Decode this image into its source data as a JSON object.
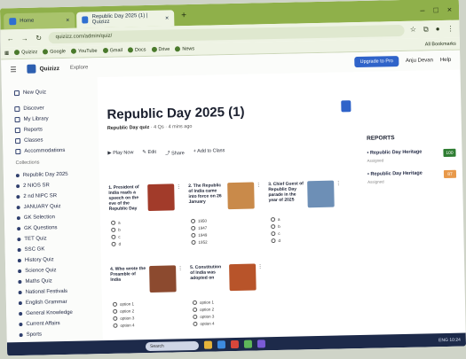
{
  "browser": {
    "tabs": [
      {
        "label": "Home"
      },
      {
        "label": "Republic Day 2025 (1) | Quizizz"
      }
    ],
    "url": "quizizz.com/admin/quiz/",
    "bookmarks": [
      "Quizizz",
      "Google",
      "YouTube",
      "Gmail",
      "Docs",
      "Drive",
      "News",
      "All Bookmarks"
    ]
  },
  "app": {
    "brand": "Quizizz",
    "nav_link": "Explore",
    "upgrade_label": "Upgrade to Pro",
    "user_label": "Anju Devan",
    "help_label": "Help"
  },
  "sidebar": {
    "top_items": [
      "New Quiz",
      "Discover",
      "My Library",
      "Reports",
      "Classes",
      "Accommodations"
    ],
    "section_label": "Collections",
    "collections": [
      "Republic Day 2025",
      "2 NIOS SR",
      "2 nd NIPC SR",
      "JANUARY Quiz",
      "GK Selection",
      "GK Questions",
      "TET Quiz",
      "SSC GK",
      "History Quiz",
      "Science Quiz",
      "Maths Quiz",
      "National Festivals",
      "English Grammar",
      "General Knowledge",
      "Current Affairs",
      "Sports"
    ]
  },
  "main": {
    "title": "Republic Day 2025 (1)",
    "subtitle_bold": "Republic Day quiz",
    "subtitle_rest": " · 4 Qs · 4 mins ago",
    "actions": [
      "Play Now",
      "Edit",
      "Share",
      "Add to Class"
    ],
    "cards": [
      {
        "title": "1. President of India reads a speech on the eve of the Republic Day",
        "thumb": "#a23b2a",
        "options": [
          "a",
          "b",
          "c",
          "d"
        ]
      },
      {
        "title": "2. The Republic of India came into force on 26 January",
        "thumb": "#c98a4a",
        "options": [
          "1950",
          "1947",
          "1949",
          "1952"
        ]
      },
      {
        "title": "3. Chief Guest of Republic Day parade in the year of 2025",
        "thumb": "#6d8fb6",
        "options": [
          "a",
          "b",
          "c",
          "d"
        ]
      },
      {
        "title": "4. Who wrote the Preamble of India",
        "thumb": "#8c4a2f",
        "options": [
          "option 1",
          "option 2",
          "option 3",
          "option 4"
        ]
      },
      {
        "title": "5. Constitution of India was adopted on",
        "thumb": "#b8542a",
        "options": [
          "option 1",
          "option 2",
          "option 3",
          "option 4"
        ]
      }
    ]
  },
  "reports": {
    "heading": "REPORTS",
    "items": [
      {
        "name": "Republic Day Heritage",
        "meta": "Assigned",
        "score": "100",
        "color": "#2e7d32"
      },
      {
        "name": "Republic Day Heritage",
        "meta": "Assigned",
        "score": "87",
        "color": "#e8994a"
      }
    ]
  },
  "taskbar": {
    "search": "Search",
    "clock": "ENG 10:24"
  }
}
